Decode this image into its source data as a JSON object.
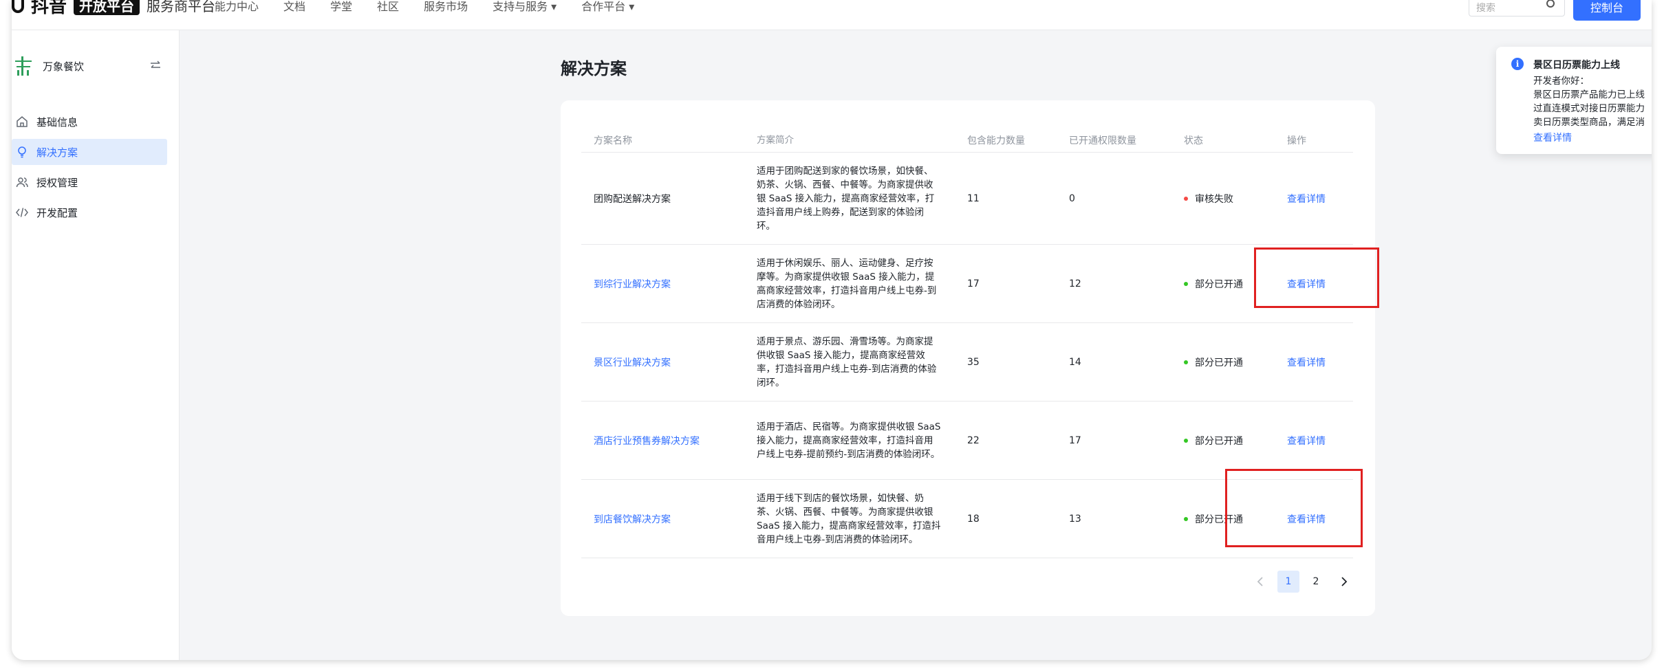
{
  "topnav": {
    "brand_name": "抖音",
    "brand_badge": "开放平台",
    "brand_sub": "服务商平台",
    "items": [
      "能力中心",
      "文档",
      "学堂",
      "社区",
      "服务市场",
      "支持与服务 ▾",
      "合作平台 ▾"
    ],
    "search_placeholder": "搜索",
    "action_label": "控制台"
  },
  "sidebar": {
    "app_name": "万象餐饮",
    "items": [
      {
        "label": "基础信息",
        "icon": "home-icon",
        "active": false
      },
      {
        "label": "解决方案",
        "icon": "bulb-icon",
        "active": true
      },
      {
        "label": "授权管理",
        "icon": "users-icon",
        "active": false
      },
      {
        "label": "开发配置",
        "icon": "code-icon",
        "active": false
      }
    ]
  },
  "main": {
    "title": "解决方案",
    "columns": [
      "方案名称",
      "方案简介",
      "包含能力数量",
      "已开通权限数量",
      "状态",
      "操作"
    ],
    "rows": [
      {
        "name": "团购配送解决方案",
        "name_link": false,
        "desc": "适用于团购配送到家的餐饮场景，如快餐、奶茶、火锅、西餐、中餐等。为商家提供收银 SaaS 接入能力，提高商家经营效率，打造抖音用户线上购券，配送到家的体验闭环。",
        "abilities": "11",
        "opened": "0",
        "status": "审核失败",
        "status_color": "#f54a45",
        "action": "查看详情"
      },
      {
        "name": "到综行业解决方案",
        "name_link": true,
        "desc": "适用于休闲娱乐、丽人、运动健身、足疗按摩等。为商家提供收银 SaaS 接入能力，提高商家经营效率，打造抖音用户线上屯券-到店消费的体验闭环。",
        "abilities": "17",
        "opened": "12",
        "status": "部分已开通",
        "status_color": "#34c724",
        "action": "查看详情"
      },
      {
        "name": "景区行业解决方案",
        "name_link": true,
        "desc": "适用于景点、游乐园、滑雪场等。为商家提供收银 SaaS 接入能力，提高商家经营效率，打造抖音用户线上屯券-到店消费的体验闭环。",
        "abilities": "35",
        "opened": "14",
        "status": "部分已开通",
        "status_color": "#34c724",
        "action": "查看详情"
      },
      {
        "name": "酒店行业预售券解决方案",
        "name_link": true,
        "desc": "适用于酒店、民宿等。为商家提供收银 SaaS 接入能力，提高商家经营效率，打造抖音用户线上屯券-提前预约-到店消费的体验闭环。",
        "abilities": "22",
        "opened": "17",
        "status": "部分已开通",
        "status_color": "#34c724",
        "action": "查看详情"
      },
      {
        "name": "到店餐饮解决方案",
        "name_link": true,
        "desc": "适用于线下到店的餐饮场景，如快餐、奶茶、火锅、西餐、中餐等。为商家提供收银 SaaS 接入能力，提高商家经营效率，打造抖音用户线上屯券-到店消费的体验闭环。",
        "abilities": "18",
        "opened": "13",
        "status": "部分已开通",
        "status_color": "#34c724",
        "action": "查看详情"
      }
    ],
    "pagination": {
      "pages": [
        "1",
        "2"
      ],
      "current": "1"
    }
  },
  "notice": {
    "title": "景区日历票能力上线",
    "greeting": "开发者你好：",
    "lines": [
      "景区日历票产品能力已上线",
      "过直连模式对接日历票能力",
      "卖日历票类型商品，满足消"
    ],
    "link": "查看详情"
  },
  "colors": {
    "accent": "#3370ff",
    "annotation": "#e02020"
  }
}
